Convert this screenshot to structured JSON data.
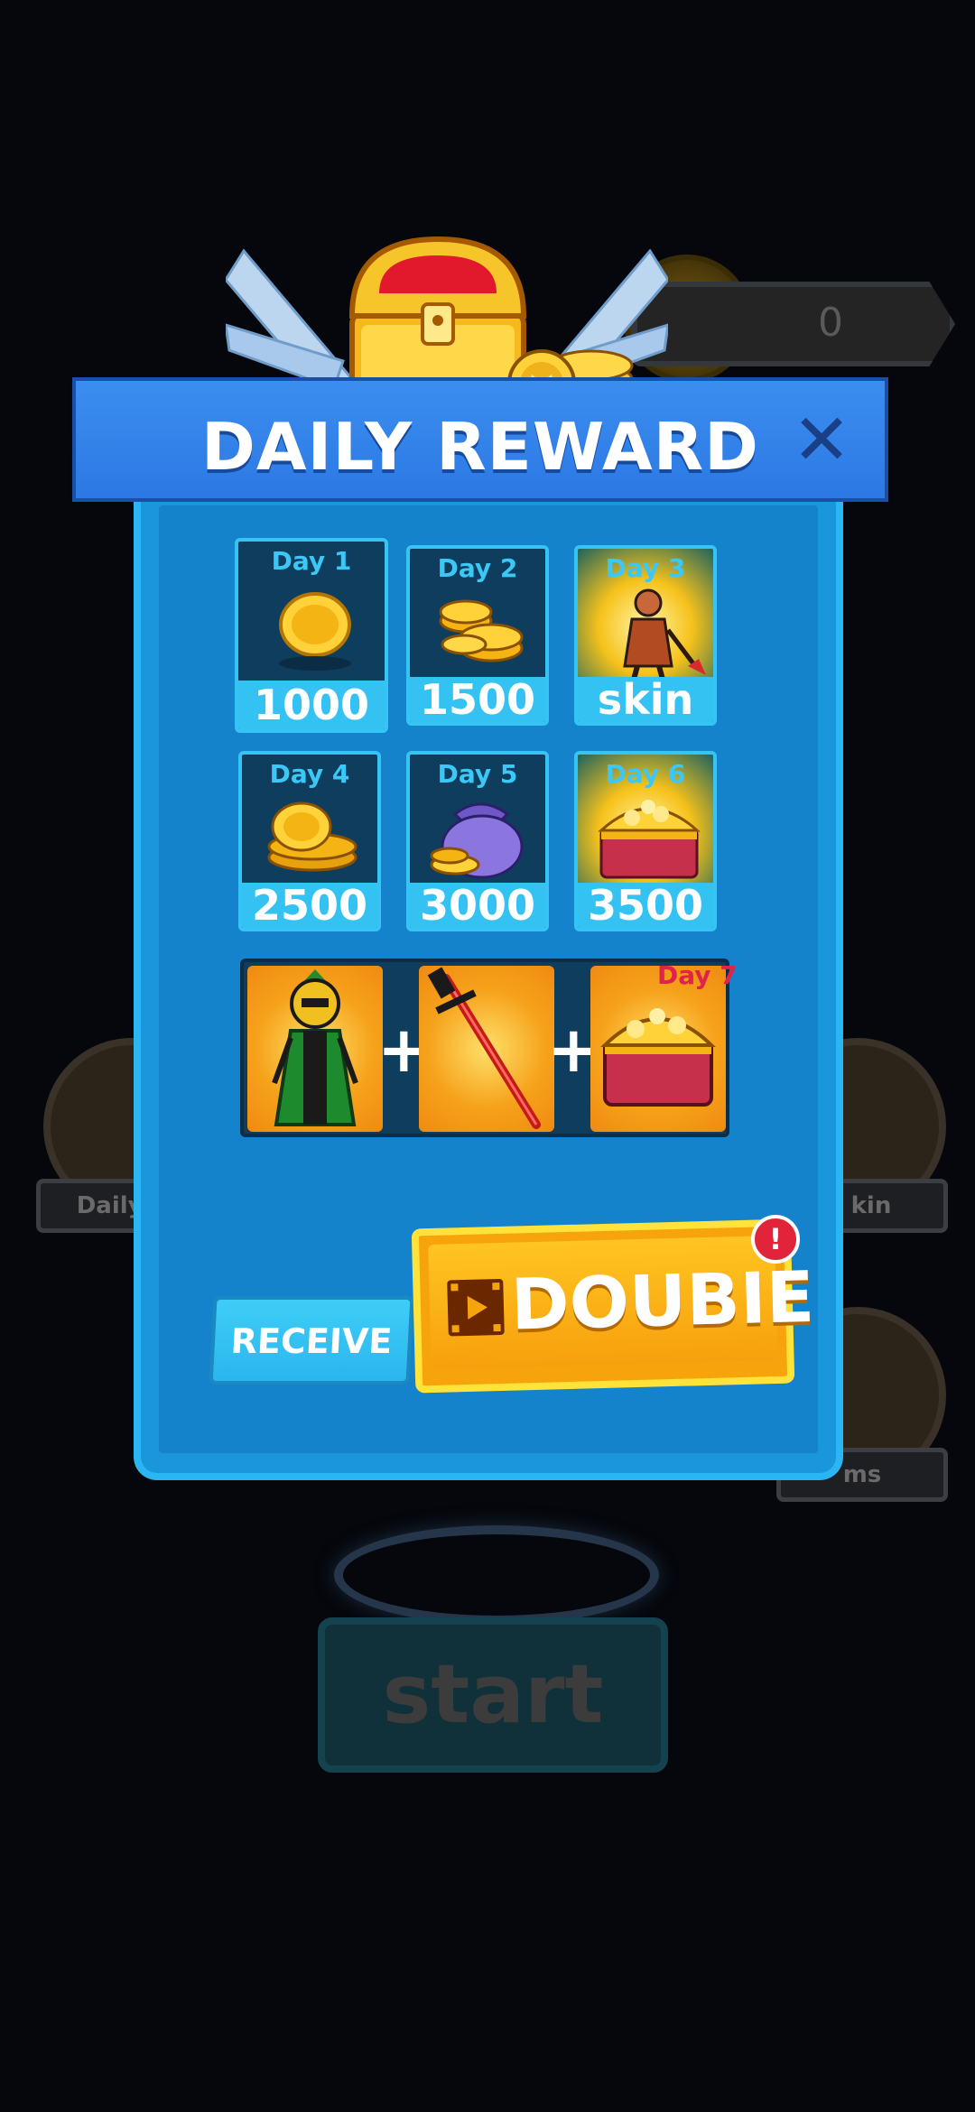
{
  "background": {
    "coin_counter": "0",
    "side_buttons": [
      "Daily Re",
      "kin",
      "ms"
    ],
    "start_label": "start"
  },
  "dialog": {
    "title": "DAILY REWARD",
    "close_icon": "close-icon",
    "days": [
      {
        "label": "Day 1",
        "amount": "1000",
        "icon": "single-coin-icon"
      },
      {
        "label": "Day 2",
        "amount": "1500",
        "icon": "coin-stack-icon"
      },
      {
        "label": "Day 3",
        "amount": "skin",
        "icon": "character-skin-icon"
      },
      {
        "label": "Day 4",
        "amount": "2500",
        "icon": "coin-pile-icon"
      },
      {
        "label": "Day 5",
        "amount": "3000",
        "icon": "coin-bag-icon"
      },
      {
        "label": "Day 6",
        "amount": "3500",
        "icon": "treasure-chest-icon"
      }
    ],
    "day7": {
      "label": "Day 7",
      "items": [
        "character-skin-icon",
        "red-sword-icon",
        "treasure-chest-icon"
      ],
      "plus": "+"
    },
    "receive_label": "RECEIVE",
    "double_label": "DOUBIE",
    "double_badge": "!"
  },
  "colors": {
    "panel": "#1a96dc",
    "header": "#2c78e4",
    "accent": "#34c2f2",
    "double_button": "#f7a30c"
  }
}
